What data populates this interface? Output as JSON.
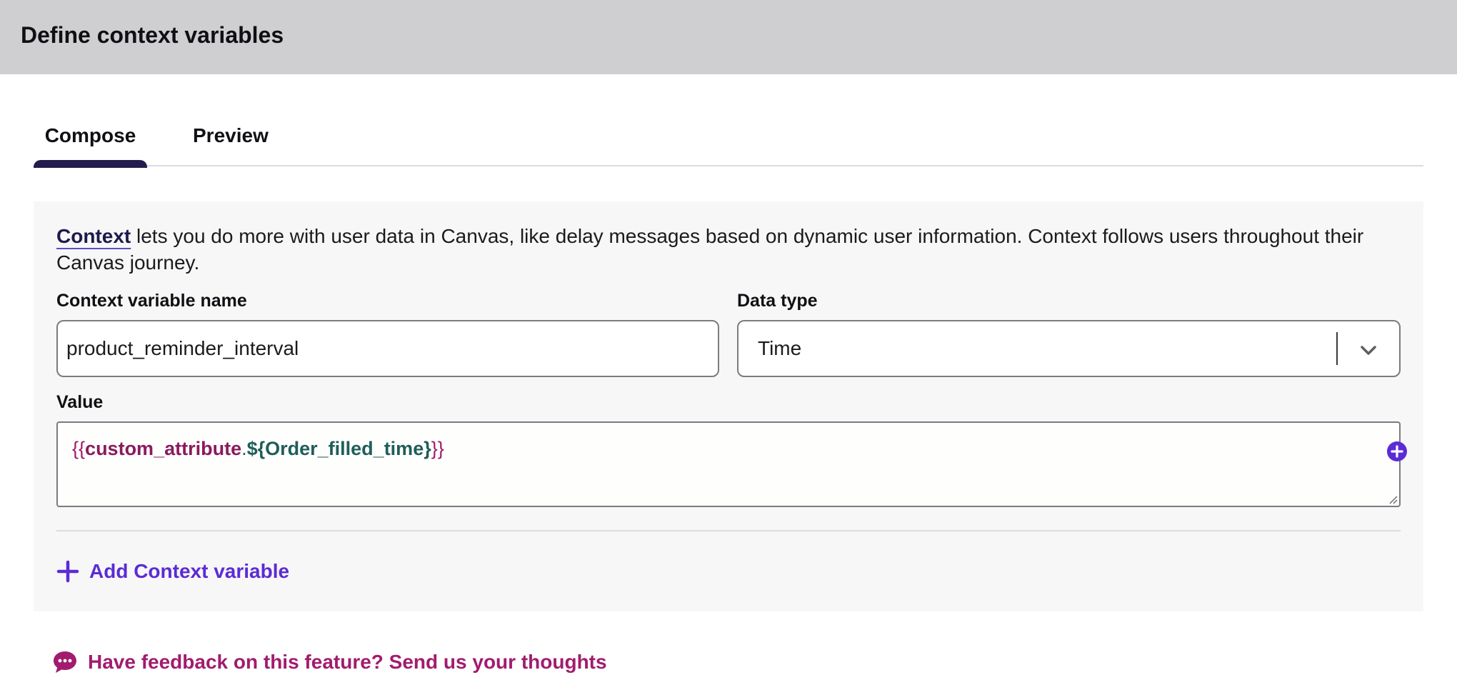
{
  "header": {
    "title": "Define context variables"
  },
  "tabs": [
    {
      "label": "Compose",
      "active": true
    },
    {
      "label": "Preview",
      "active": false
    }
  ],
  "intro": {
    "link_text": "Context",
    "text": " lets you do more with user data in Canvas, like delay messages based on dynamic user information. Context follows users throughout their Canvas journey."
  },
  "form": {
    "name_label": "Context variable name",
    "name_value": "product_reminder_interval",
    "type_label": "Data type",
    "type_value": "Time",
    "value_label": "Value",
    "value_code": {
      "open": "{{",
      "attr": "custom_attribute",
      "dot": ".",
      "var": "${Order_filled_time}",
      "close": "}}"
    }
  },
  "add_button": {
    "label": "Add Context variable"
  },
  "feedback": {
    "label": "Have feedback on this feature? Send us your thoughts"
  },
  "colors": {
    "header_bg": "#cfcfd2",
    "tab_indicator": "#241c4d",
    "accent_purple": "#5b2bd6",
    "feedback_magenta": "#a11c6e",
    "code_attr": "#8a1a5e",
    "code_var": "#1f5d5a"
  },
  "icons": {
    "select_caret": "chevron-down-icon",
    "value_insert": "plus-circle-icon",
    "add": "plus-icon",
    "feedback": "chat-bubble-icon"
  }
}
